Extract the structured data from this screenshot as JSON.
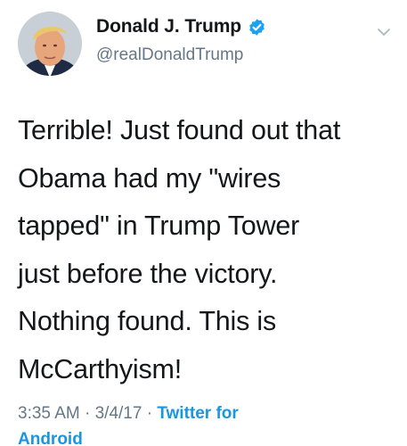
{
  "user": {
    "display_name": "Donald J. Trump",
    "handle": "@realDonaldTrump",
    "verified": true,
    "avatar_icon": "profile-photo"
  },
  "tweet": {
    "lines": [
      "Terrible! Just found out that",
      "Obama had my \"wires",
      "tapped\" in Trump Tower",
      "just before the victory.",
      "Nothing found. This is",
      "McCarthyism!"
    ]
  },
  "meta": {
    "time": "3:35 AM",
    "separator": " · ",
    "date": "3/4/17",
    "source_line1": "Twitter for",
    "source_line2": "Android"
  },
  "colors": {
    "verified_badge": "#1da1f2",
    "link": "#1b95e0",
    "secondary_text": "#657786"
  }
}
